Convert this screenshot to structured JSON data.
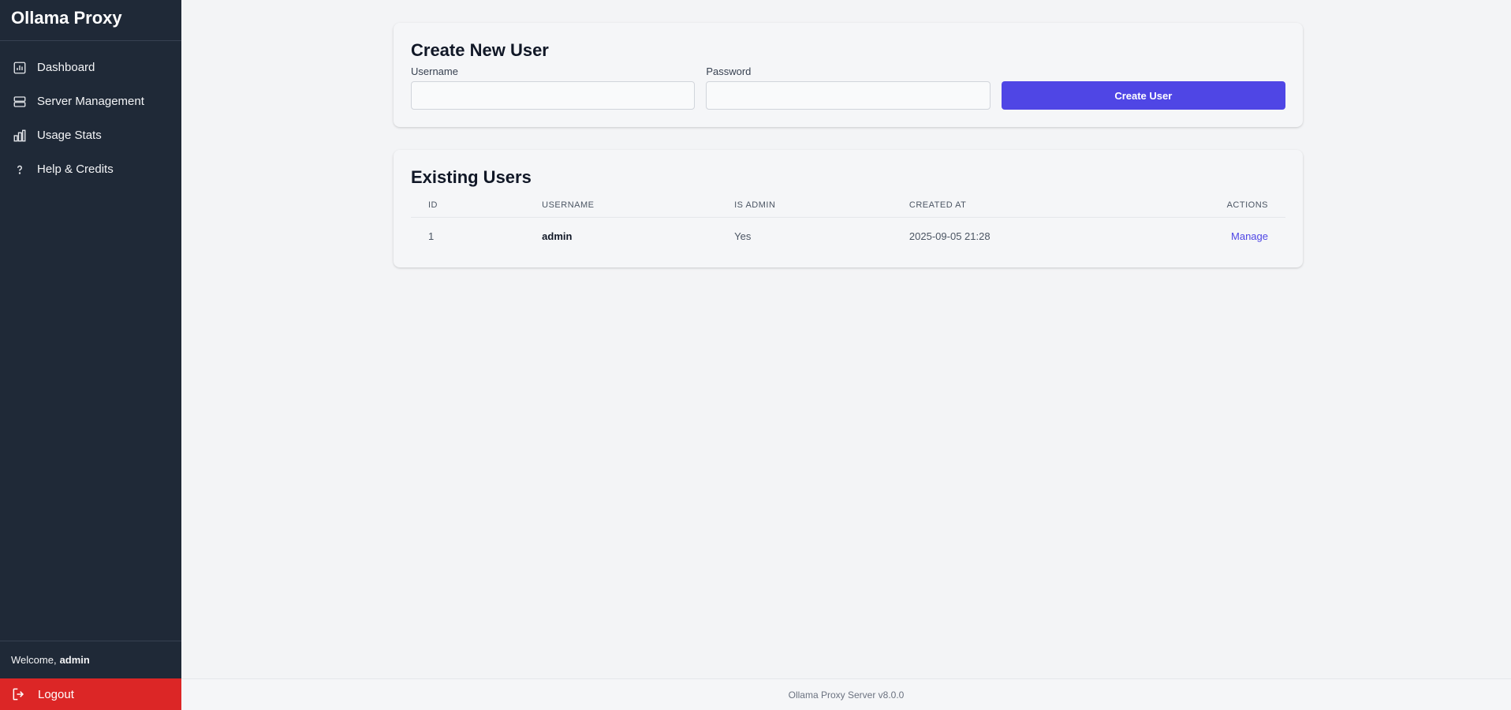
{
  "app": {
    "title": "Ollama Proxy"
  },
  "sidebar": {
    "items": [
      {
        "label": "Dashboard",
        "icon": "dashboard-icon"
      },
      {
        "label": "Server Management",
        "icon": "server-icon"
      },
      {
        "label": "Usage Stats",
        "icon": "bar-chart-icon"
      },
      {
        "label": "Help & Credits",
        "icon": "help-icon"
      }
    ],
    "welcome_prefix": "Welcome,",
    "welcome_user": "admin",
    "logout_label": "Logout"
  },
  "create_user": {
    "title": "Create New User",
    "username_label": "Username",
    "username_value": "",
    "password_label": "Password",
    "password_value": "",
    "submit_label": "Create User"
  },
  "users": {
    "title": "Existing Users",
    "columns": [
      "ID",
      "USERNAME",
      "IS ADMIN",
      "CREATED AT",
      "ACTIONS"
    ],
    "rows": [
      {
        "id": "1",
        "username": "admin",
        "is_admin": "Yes",
        "created_at": "2025-09-05 21:28",
        "action": "Manage"
      }
    ]
  },
  "footer": {
    "text": "Ollama Proxy Server v8.0.0"
  },
  "colors": {
    "sidebar_bg": "#1f2937",
    "accent": "#4f46e5",
    "logout_bg": "#dc2626"
  }
}
